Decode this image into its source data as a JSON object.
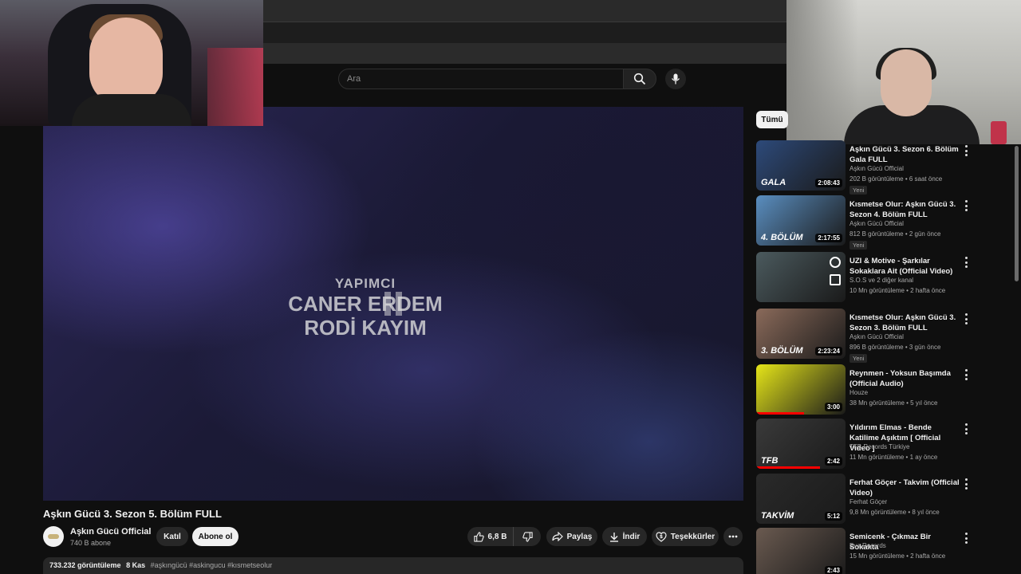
{
  "search": {
    "placeholder": "Ara"
  },
  "video": {
    "credits_role": "YAPIMCI",
    "credits_names": [
      "CANER ERDEM",
      "RODİ KAYIM"
    ],
    "title": "Aşkın Gücü 3. Sezon 5. Bölüm FULL",
    "channel": "Aşkın Gücü Official",
    "subscribers": "740 B abone",
    "join_label": "Katıl",
    "subscribe_label": "Abone ol",
    "likes": "6,8 B",
    "share_label": "Paylaş",
    "download_label": "İndir",
    "thanks_label": "Teşekkürler",
    "views": "733.232 görüntüleme",
    "date": "8 Kas",
    "hashtags": "#aşkıngücü #askingucu #kısmetseolur"
  },
  "sidebar": {
    "chip": "Tümü",
    "items": [
      {
        "title": "Aşkın Gücü 3. Sezon 6. Bölüm Gala FULL",
        "channel": "Aşkın Gücü Official",
        "meta": "202 B görüntüleme • 6 saat önce",
        "duration": "2:08:43",
        "badge": "Yeni",
        "thumb_text": "GALA",
        "thumb_color": "#2d4a7a"
      },
      {
        "title": "Kısmetse Olur: Aşkın Gücü 3. Sezon 4. Bölüm FULL",
        "channel": "Aşkın Gücü Official",
        "meta": "812 B görüntüleme • 2 gün önce",
        "duration": "2:17:55",
        "badge": "Yeni",
        "thumb_text": "4. BÖLÜM",
        "thumb_color": "#5a8ec0"
      },
      {
        "title": "UZI & Motive - Şarkılar Sokaklara Ait (Official Video)",
        "channel": "S.O.S ve 2 diğer kanal",
        "meta": "10 Mn görüntüleme • 2 hafta önce",
        "duration": "",
        "badge": "",
        "thumb_text": "",
        "thumb_color": "#4b5a5e"
      },
      {
        "title": "Kısmetse Olur: Aşkın Gücü 3. Sezon 3. Bölüm FULL",
        "channel": "Aşkın Gücü Official",
        "meta": "896 B görüntüleme • 3 gün önce",
        "duration": "2:23:24",
        "badge": "Yeni",
        "thumb_text": "3. BÖLÜM",
        "thumb_color": "#8a6a5a"
      },
      {
        "title": "Reynmen - Yoksun Başımda (Official Audio)",
        "channel": "Houze",
        "meta": "38 Mn görüntüleme • 5 yıl önce",
        "duration": "3:00",
        "badge": "",
        "thumb_text": "",
        "thumb_color": "#e6e619"
      },
      {
        "title": "Yıldırım Elmas - Bende Katilime Aşıktım [ Official Video ]",
        "channel": "TFB Records Türkiye",
        "meta": "11 Mn görüntüleme • 1 ay önce",
        "duration": "2:42",
        "badge": "",
        "thumb_text": "TFB",
        "thumb_color": "#3a3a3a"
      },
      {
        "title": "Ferhat Göçer - Takvim (Official Video)",
        "channel": "Ferhat Göçer",
        "meta": "9,8 Mn görüntüleme • 8 yıl önce",
        "duration": "5:12",
        "badge": "",
        "thumb_text": "TAKVİM",
        "thumb_color": "#2a2a2a"
      },
      {
        "title": "Semicenk - Çıkmaz Bir Sokakta",
        "channel": "Eva Records",
        "meta": "15 Mn görüntüleme • 2 hafta önce",
        "duration": "2:43",
        "badge": "",
        "thumb_text": "",
        "thumb_color": "#6a5a50"
      }
    ]
  }
}
